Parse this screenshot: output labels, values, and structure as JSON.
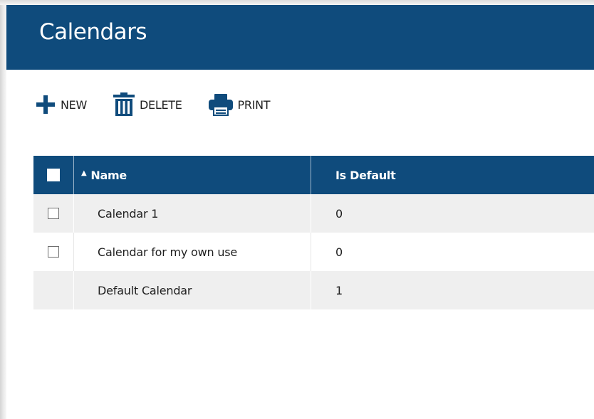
{
  "header": {
    "title": "Calendars"
  },
  "toolbar": {
    "new_label": "NEW",
    "delete_label": "DELETE",
    "print_label": "PRINT",
    "new_icon": "plus-icon",
    "delete_icon": "trash-icon",
    "print_icon": "printer-icon"
  },
  "grid": {
    "columns": [
      {
        "label": "Name",
        "sort": "ascending"
      },
      {
        "label": "Is Default"
      }
    ],
    "rows": [
      {
        "name": "Calendar 1",
        "is_default": "0",
        "has_checkbox": true
      },
      {
        "name": "Calendar for my own use",
        "is_default": "0",
        "has_checkbox": true
      },
      {
        "name": "Default Calendar",
        "is_default": "1",
        "has_checkbox": false
      }
    ]
  },
  "colors": {
    "accent": "#0f4b7c",
    "row_alt": "#efefef"
  }
}
